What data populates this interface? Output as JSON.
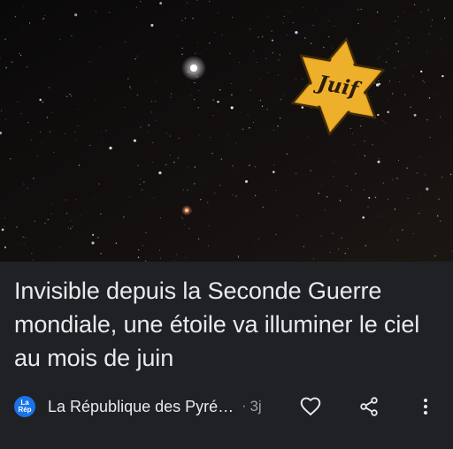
{
  "article": {
    "title": "Invisible depuis la Seconde Guerre mondiale, une étoile va illuminer le ciel au mois de juin",
    "publisher": "La République des Pyré…",
    "publisher_logo_text": "La\nRép",
    "separator": "·",
    "age": "3j",
    "badge_text": "Juif"
  },
  "icons": {
    "like": "heart-outline-icon",
    "share": "share-icon",
    "more": "more-vertical-icon"
  },
  "colors": {
    "background": "#202124",
    "title_text": "#e8eaed",
    "meta_text": "#9aa0a6",
    "publisher_logo": "#1a73e8",
    "star_badge": "#e9a51f"
  }
}
